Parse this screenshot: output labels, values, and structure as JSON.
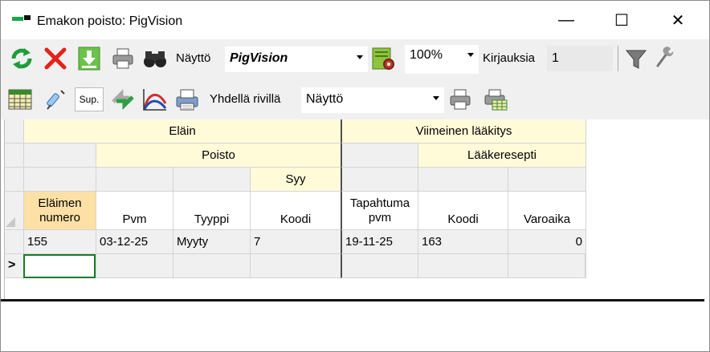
{
  "window": {
    "title": "Emakon poisto: PigVision",
    "minimize_glyph": "—",
    "maximize_glyph": "☐",
    "close_glyph": "✕"
  },
  "toolbar1": {
    "naytto_label": "Näyttö",
    "naytto_value": "PigVision",
    "zoom_value": "100%",
    "kirjauksia_label": "Kirjauksia",
    "kirjauksia_value": "1"
  },
  "toolbar2": {
    "sup_label": "Sup.",
    "yhdella_label": "Yhdellä rivillä",
    "yhdella_value": "Näyttö"
  },
  "grid": {
    "group1": "Eläin",
    "group2": "Viimeinen lääkitys",
    "subgroup_poisto": "Poisto",
    "subgroup_laakeresepti": "Lääkeresepti",
    "subgroup_syy": "Syy",
    "columns": [
      "Eläimen numero",
      "Pvm",
      "Tyyppi",
      "Koodi",
      "Tapahtuma pvm",
      "Koodi",
      "Varoaika"
    ],
    "rows": [
      [
        "155",
        "03-12-25",
        "Myyty",
        "7",
        "19-11-25",
        "163",
        "0"
      ]
    ],
    "new_row_marker": ">"
  },
  "colors": {
    "header_yellow": "#fffbd9",
    "header_gray": "#f0f0f0",
    "selected_header": "#fde0a6",
    "active_cell_border": "#1a7a2a",
    "toolbar_bg": "#f0f0f0"
  },
  "icons": [
    "app-icon",
    "refresh-icon",
    "delete-icon",
    "download-icon",
    "print-icon",
    "binoculars-icon",
    "settings-report-icon",
    "filter-icon",
    "wrench-icon",
    "calendar-grid-icon",
    "syringe-icon",
    "sup-icon",
    "arrows-icon",
    "curve-chart-icon",
    "printer-list-icon",
    "print-preview-icon"
  ]
}
